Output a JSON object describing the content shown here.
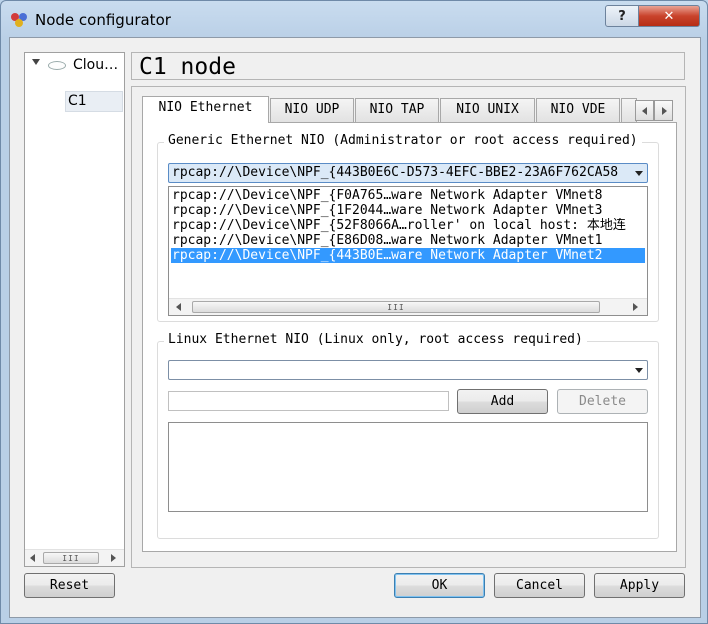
{
  "window": {
    "title": "Node configurator",
    "help_glyph": "?",
    "close_glyph": "✕"
  },
  "tree": {
    "items": [
      {
        "label": "Clou…"
      },
      {
        "label": "C1"
      }
    ]
  },
  "header": {
    "title": "C1 node"
  },
  "tabs": [
    {
      "label": "NIO Ethernet",
      "active": true
    },
    {
      "label": "NIO UDP"
    },
    {
      "label": "NIO TAP"
    },
    {
      "label": "NIO UNIX"
    },
    {
      "label": "NIO VDE"
    }
  ],
  "generic": {
    "title": "Generic Ethernet NIO (Administrator or root access required)",
    "combo_value": "rpcap://\\Device\\NPF_{443B0E6C-D573-4EFC-BBE2-23A6F762CA58",
    "list": [
      {
        "label": "rpcap://\\Device\\NPF_{F0A765…ware Network Adapter VMnet8"
      },
      {
        "label": "rpcap://\\Device\\NPF_{1F2044…ware Network Adapter VMnet3"
      },
      {
        "label": "rpcap://\\Device\\NPF_{52F8066A…roller' on local host: 本地连"
      },
      {
        "label": "rpcap://\\Device\\NPF_{E86D08…ware Network Adapter VMnet1"
      },
      {
        "label": "rpcap://\\Device\\NPF_{443B0E…ware Network Adapter VMnet2",
        "selected": true
      }
    ]
  },
  "linux": {
    "title": "Linux Ethernet NIO (Linux only, root access required)",
    "combo_value": "",
    "input_value": "",
    "add_label": "Add",
    "delete_label": "Delete"
  },
  "footer": {
    "reset_label": "Reset",
    "ok_label": "OK",
    "cancel_label": "Cancel",
    "apply_label": "Apply"
  },
  "scroll_thumb_glyph": "III"
}
